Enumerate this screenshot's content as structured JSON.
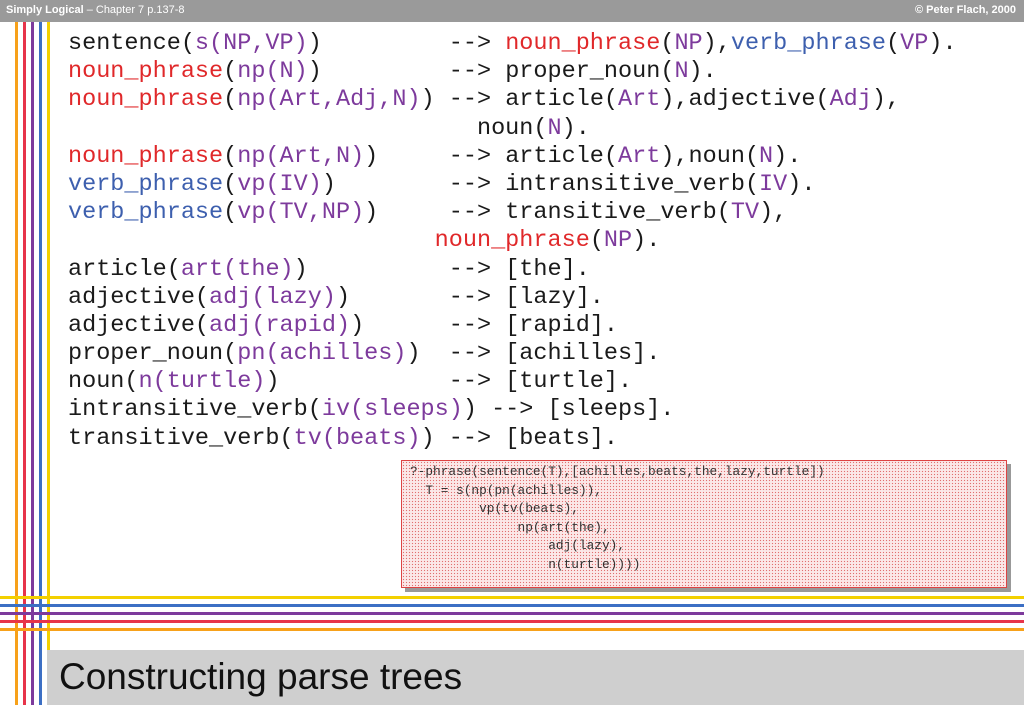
{
  "header": {
    "book_title": "Simply Logical",
    "chapter": " – Chapter 7  p.137-8",
    "copyright": "© Peter Flach, 2000"
  },
  "colors": {
    "red": "#e0282a",
    "blue": "#3d5fae",
    "purple": "#7d3a9c",
    "dark": "#1a1a1a",
    "header_bg": "#9a9a9a",
    "title_bg": "#cfcfcf"
  },
  "stripes": [
    "#f7a11a",
    "#e7344a",
    "#7d3a9c",
    "#3c6fc4",
    "#f3d000"
  ],
  "code_lines": [
    [
      {
        "t": "sentence(",
        "c": "dark"
      },
      {
        "t": "s(NP,VP)",
        "c": "purple"
      },
      {
        "t": ")         --> ",
        "c": "dark"
      },
      {
        "t": "noun_phrase",
        "c": "red"
      },
      {
        "t": "(",
        "c": "dark"
      },
      {
        "t": "NP",
        "c": "purple"
      },
      {
        "t": "),",
        "c": "dark"
      },
      {
        "t": "verb_phrase",
        "c": "blue"
      },
      {
        "t": "(",
        "c": "dark"
      },
      {
        "t": "VP",
        "c": "purple"
      },
      {
        "t": ").",
        "c": "dark"
      }
    ],
    [
      {
        "t": "noun_phrase",
        "c": "red"
      },
      {
        "t": "(",
        "c": "dark"
      },
      {
        "t": "np(N)",
        "c": "purple"
      },
      {
        "t": ")         --> proper_noun(",
        "c": "dark"
      },
      {
        "t": "N",
        "c": "purple"
      },
      {
        "t": ").",
        "c": "dark"
      }
    ],
    [
      {
        "t": "noun_phrase",
        "c": "red"
      },
      {
        "t": "(",
        "c": "dark"
      },
      {
        "t": "np(Art,Adj,N)",
        "c": "purple"
      },
      {
        "t": ") --> article(",
        "c": "dark"
      },
      {
        "t": "Art",
        "c": "purple"
      },
      {
        "t": "),adjective(",
        "c": "dark"
      },
      {
        "t": "Adj",
        "c": "purple"
      },
      {
        "t": "),",
        "c": "dark"
      }
    ],
    [
      {
        "t": "                             noun(",
        "c": "dark"
      },
      {
        "t": "N",
        "c": "purple"
      },
      {
        "t": ").",
        "c": "dark"
      }
    ],
    [
      {
        "t": "noun_phrase",
        "c": "red"
      },
      {
        "t": "(",
        "c": "dark"
      },
      {
        "t": "np(Art,N)",
        "c": "purple"
      },
      {
        "t": ")     --> article(",
        "c": "dark"
      },
      {
        "t": "Art",
        "c": "purple"
      },
      {
        "t": "),noun(",
        "c": "dark"
      },
      {
        "t": "N",
        "c": "purple"
      },
      {
        "t": ").",
        "c": "dark"
      }
    ],
    [
      {
        "t": "verb_phrase",
        "c": "blue"
      },
      {
        "t": "(",
        "c": "dark"
      },
      {
        "t": "vp(IV)",
        "c": "purple"
      },
      {
        "t": ")        --> intransitive_verb(",
        "c": "dark"
      },
      {
        "t": "IV",
        "c": "purple"
      },
      {
        "t": ").",
        "c": "dark"
      }
    ],
    [
      {
        "t": "verb_phrase",
        "c": "blue"
      },
      {
        "t": "(",
        "c": "dark"
      },
      {
        "t": "vp(TV,NP)",
        "c": "purple"
      },
      {
        "t": ")     --> transitive_verb(",
        "c": "dark"
      },
      {
        "t": "TV",
        "c": "purple"
      },
      {
        "t": "),",
        "c": "dark"
      }
    ],
    [
      {
        "t": "                          ",
        "c": "dark"
      },
      {
        "t": "noun_phrase",
        "c": "red"
      },
      {
        "t": "(",
        "c": "dark"
      },
      {
        "t": "NP",
        "c": "purple"
      },
      {
        "t": ").",
        "c": "dark"
      }
    ],
    [
      {
        "t": "article(",
        "c": "dark"
      },
      {
        "t": "art(the)",
        "c": "purple"
      },
      {
        "t": ")          --> [the].",
        "c": "dark"
      }
    ],
    [
      {
        "t": "adjective(",
        "c": "dark"
      },
      {
        "t": "adj(lazy)",
        "c": "purple"
      },
      {
        "t": ")       --> [lazy].",
        "c": "dark"
      }
    ],
    [
      {
        "t": "adjective(",
        "c": "dark"
      },
      {
        "t": "adj(rapid)",
        "c": "purple"
      },
      {
        "t": ")      --> [rapid].",
        "c": "dark"
      }
    ],
    [
      {
        "t": "proper_noun(",
        "c": "dark"
      },
      {
        "t": "pn(achilles)",
        "c": "purple"
      },
      {
        "t": ")  --> [achilles].",
        "c": "dark"
      }
    ],
    [
      {
        "t": "noun(",
        "c": "dark"
      },
      {
        "t": "n(turtle)",
        "c": "purple"
      },
      {
        "t": ")            --> [turtle].",
        "c": "dark"
      }
    ],
    [
      {
        "t": "intransitive_verb(",
        "c": "dark"
      },
      {
        "t": "iv(sleeps)",
        "c": "purple"
      },
      {
        "t": ") --> [sleeps].",
        "c": "dark"
      }
    ],
    [
      {
        "t": "transitive_verb(",
        "c": "dark"
      },
      {
        "t": "tv(beats)",
        "c": "purple"
      },
      {
        "t": ") --> [beats].",
        "c": "dark"
      }
    ]
  ],
  "query_output": [
    "?-phrase(sentence(T),[achilles,beats,the,lazy,turtle])",
    "  T = s(np(pn(achilles)),",
    "         vp(tv(beats),",
    "              np(art(the),",
    "                  adj(lazy),",
    "                  n(turtle))))"
  ],
  "slide_title": "Constructing parse trees"
}
